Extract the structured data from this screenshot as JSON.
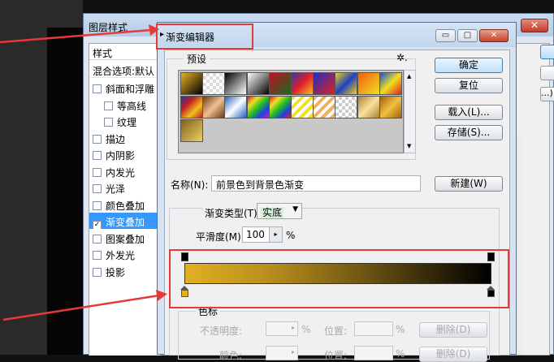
{
  "layer_style": {
    "title": "图层样式",
    "close_glyph": "✕",
    "list_header": "样式",
    "blend_options": "混合选项:默认",
    "items": [
      {
        "label": "斜面和浮雕",
        "checked": false,
        "indent": false
      },
      {
        "label": "等高线",
        "checked": false,
        "indent": true
      },
      {
        "label": "纹理",
        "checked": false,
        "indent": true
      },
      {
        "label": "描边",
        "checked": false,
        "indent": false
      },
      {
        "label": "内阴影",
        "checked": false,
        "indent": false
      },
      {
        "label": "内发光",
        "checked": false,
        "indent": false
      },
      {
        "label": "光泽",
        "checked": false,
        "indent": false
      },
      {
        "label": "颜色叠加",
        "checked": false,
        "indent": false
      },
      {
        "label": "渐变叠加",
        "checked": true,
        "indent": false,
        "selected": true
      },
      {
        "label": "图案叠加",
        "checked": false,
        "indent": false
      },
      {
        "label": "外发光",
        "checked": false,
        "indent": false
      },
      {
        "label": "投影",
        "checked": false,
        "indent": false
      }
    ],
    "right_btn_ellipsis": "...)"
  },
  "gradient_editor": {
    "title": "渐变编辑器",
    "min_glyph": "▭",
    "max_glyph": "□",
    "close_glyph": "✕",
    "presets_label": "预设",
    "gear_glyph": "✲.",
    "buttons": {
      "ok": "确定",
      "reset": "复位",
      "load": "载入(L)...",
      "save": "存储(S)...",
      "new": "新建(W)"
    },
    "name_label": "名称(N):",
    "name_value": "前景色到背景色渐变",
    "gradient_type_label": "渐变类型(T):",
    "gradient_type_value": "实底",
    "smoothness_label": "平滑度(M):",
    "smoothness_value": "100",
    "smoothness_unit": "%",
    "color_stops_label": "色标",
    "opacity_label": "不透明度:",
    "color_label": "颜色:",
    "position_label": "位置:",
    "pct": "%",
    "delete_label": "删除(D)"
  },
  "colors": {
    "gradient_start": "#e1b023",
    "gradient_end": "#000000",
    "highlight": "#e5393a",
    "selection": "#3399ff"
  }
}
